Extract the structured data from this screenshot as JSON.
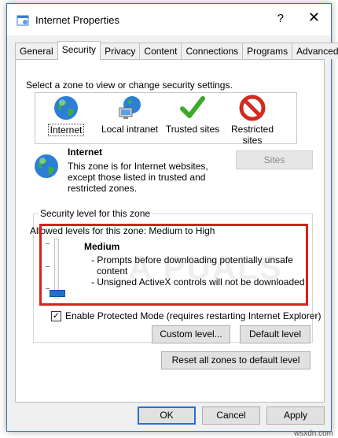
{
  "window": {
    "title": "Internet Properties",
    "help": "?",
    "close": "✕"
  },
  "tabs": [
    {
      "label": "General"
    },
    {
      "label": "Security",
      "active": true
    },
    {
      "label": "Privacy"
    },
    {
      "label": "Content"
    },
    {
      "label": "Connections"
    },
    {
      "label": "Programs"
    },
    {
      "label": "Advanced"
    }
  ],
  "security": {
    "zone_prompt": "Select a zone to view or change security settings.",
    "zones": [
      {
        "label": "Internet",
        "icon": "globe-icon",
        "selected": true
      },
      {
        "label": "Local intranet",
        "icon": "intranet-icon"
      },
      {
        "label": "Trusted sites",
        "icon": "checkmark-icon"
      },
      {
        "label_line1": "Restricted",
        "label_line2": "sites",
        "icon": "no-entry-icon"
      }
    ],
    "selected_zone": {
      "title": "Internet",
      "description_line1": "This zone is for Internet websites,",
      "description_line2": "except those listed in trusted and",
      "description_line3": "restricted zones."
    },
    "sites_button": "Sites",
    "level_group_label": "Security level for this zone",
    "allowed_levels": "Allowed levels for this zone: Medium to High",
    "level_name": "Medium",
    "level_desc_1": "- Prompts before downloading potentially unsafe",
    "level_desc_1b": "content",
    "level_desc_2": "- Unsigned ActiveX controls will not be downloaded",
    "protected_mode": "Enable Protected Mode (requires restarting Internet Explorer)",
    "protected_mode_checked": true,
    "check_mark": "✓",
    "custom_level_button": "Custom level...",
    "default_level_button": "Default level",
    "reset_all_button": "Reset all zones to default level"
  },
  "footer": {
    "ok": "OK",
    "cancel": "Cancel",
    "apply": "Apply"
  },
  "overlay": {
    "watermark": "A  PUALS",
    "corner_mark": "wsxdn.com"
  },
  "colors": {
    "highlight_border": "#d9201a",
    "slider_thumb": "#1f6fd6",
    "primary_border": "#2a6fd0"
  }
}
